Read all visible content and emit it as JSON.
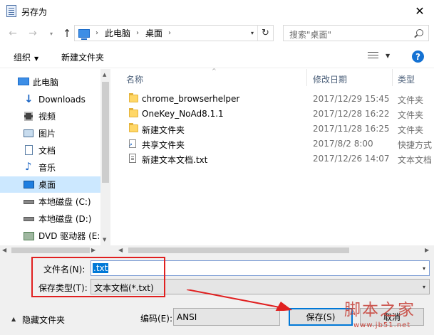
{
  "window": {
    "title": "另存为",
    "close_glyph": "✕"
  },
  "nav": {
    "back": "←",
    "forward": "→",
    "recent": "▾",
    "up": "↑",
    "refresh": "↻",
    "addr_dropdown": "▾"
  },
  "address": {
    "crumbs": [
      "此电脑",
      "桌面"
    ],
    "sep": "›"
  },
  "search": {
    "placeholder": "搜索\"桌面\""
  },
  "toolbar": {
    "organize": "组织",
    "organize_caret": "▼",
    "new_folder": "新建文件夹",
    "view_caret": "▼",
    "help": "?"
  },
  "sidebar": {
    "items": [
      {
        "label": "此电脑",
        "icon": "computer-icon"
      },
      {
        "label": "Downloads",
        "icon": "download-icon"
      },
      {
        "label": "视频",
        "icon": "video-icon"
      },
      {
        "label": "图片",
        "icon": "picture-icon"
      },
      {
        "label": "文档",
        "icon": "document-icon"
      },
      {
        "label": "音乐",
        "icon": "music-icon"
      },
      {
        "label": "桌面",
        "icon": "desktop-icon",
        "active": true
      },
      {
        "label": "本地磁盘 (C:)",
        "icon": "drive-icon"
      },
      {
        "label": "本地磁盘 (D:)",
        "icon": "drive-icon"
      },
      {
        "label": "DVD 驱动器 (E:)",
        "icon": "dvd-icon"
      }
    ],
    "scroll_up": "▲",
    "scroll_down": "▼"
  },
  "columns": {
    "name": "名称",
    "date": "修改日期",
    "type": "类型",
    "sort_caret": "^"
  },
  "files": [
    {
      "name": "chrome_browserhelper",
      "date": "2017/12/29 15:45",
      "type": "文件夹",
      "kind": "folder"
    },
    {
      "name": "OneKey_NoAd8.1.1",
      "date": "2017/12/28 16:22",
      "type": "文件夹",
      "kind": "folder"
    },
    {
      "name": "新建文件夹",
      "date": "2017/11/28 16:25",
      "type": "文件夹",
      "kind": "folder"
    },
    {
      "name": "共享文件夹",
      "date": "2017/8/2 8:00",
      "type": "快捷方式",
      "kind": "shortcut"
    },
    {
      "name": "新建文本文档.txt",
      "date": "2017/12/26 14:07",
      "type": "文本文档",
      "kind": "text"
    }
  ],
  "hscroll": {
    "left": "◀",
    "right": "▶"
  },
  "form": {
    "filename_label": "文件名(N):",
    "filename_value": ".txt",
    "filename_caret": "▾",
    "filetype_label": "保存类型(T):",
    "filetype_value": "文本文档(*.txt)",
    "filetype_caret": "▾",
    "hide_folders_caret": "▲",
    "hide_folders": "隐藏文件夹",
    "encoding_label": "编码(E):",
    "encoding_value": "ANSI",
    "save": "保存(S)",
    "cancel": "取消"
  },
  "watermark": {
    "main": "脚本之家",
    "sub": "www.jb51.net"
  },
  "colors": {
    "accent": "#0078d7",
    "highlight": "#e02020",
    "watermark": "#c8463e"
  }
}
